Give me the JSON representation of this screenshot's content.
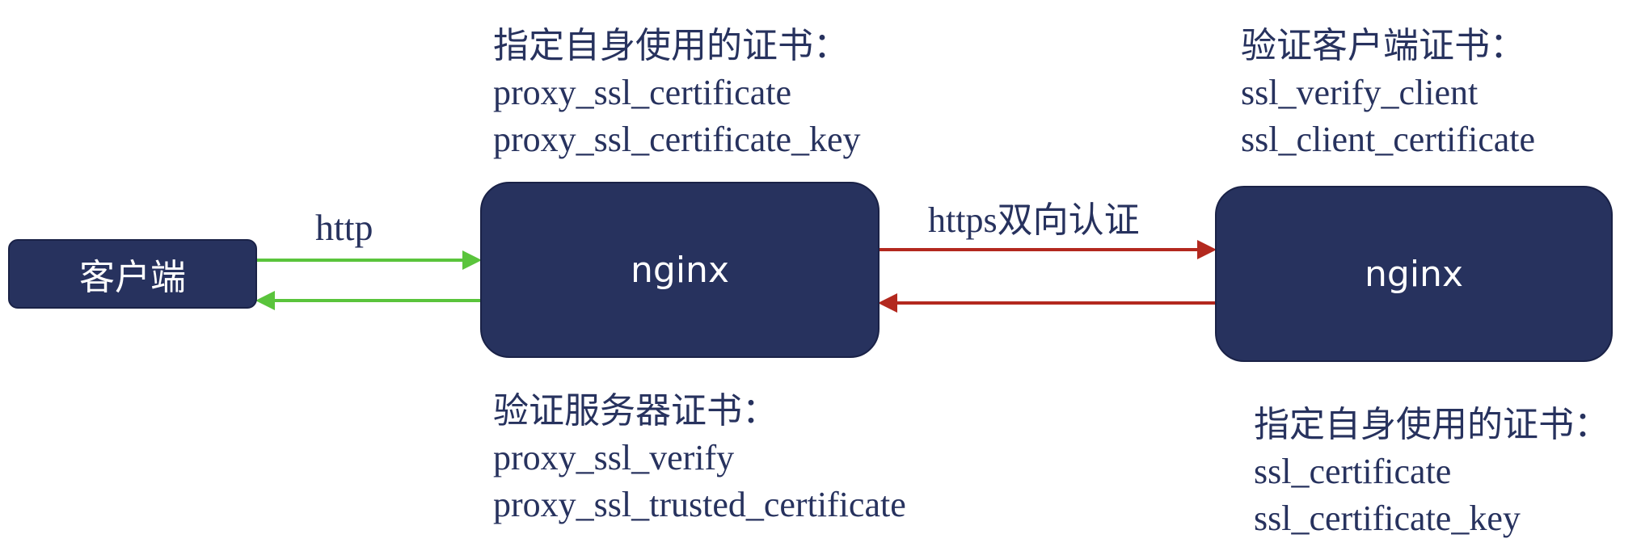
{
  "nodes": {
    "client": "客户端",
    "nginx_left": "nginx",
    "nginx_right": "nginx"
  },
  "edges": {
    "http": "http",
    "https": "https双向认证"
  },
  "notes": {
    "left_top": {
      "heading": "指定自身使用的证书：",
      "lines": [
        "proxy_ssl_certificate",
        "proxy_ssl_certificate_key"
      ]
    },
    "left_bottom": {
      "heading": "验证服务器证书：",
      "lines": [
        "proxy_ssl_verify",
        "proxy_ssl_trusted_certificate"
      ]
    },
    "right_top": {
      "heading": "验证客户端证书：",
      "lines": [
        "ssl_verify_client",
        "ssl_client_certificate"
      ]
    },
    "right_bottom": {
      "heading": "指定自身使用的证书：",
      "lines": [
        "ssl_certificate",
        "ssl_certificate_key"
      ]
    }
  },
  "colors": {
    "node_fill": "#27325e",
    "text": "#27325e",
    "http_arrow": "#5ac43c",
    "https_arrow": "#b3281e"
  }
}
